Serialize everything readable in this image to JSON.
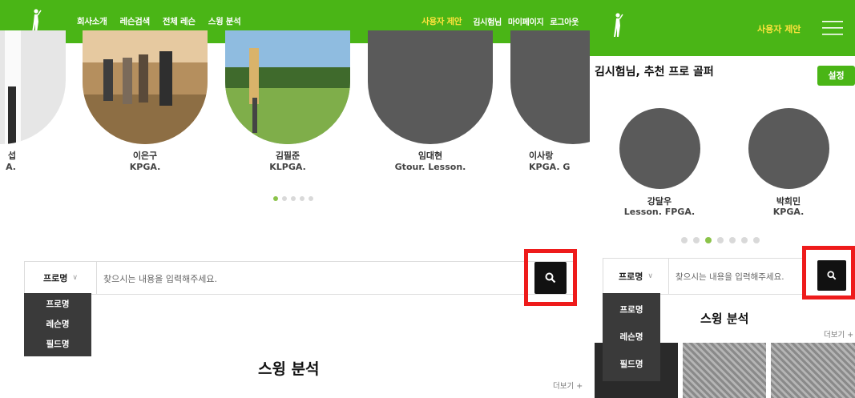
{
  "desktop": {
    "nav": [
      "회사소개",
      "레슨검색",
      "전체 레슨",
      "스윙 분석"
    ],
    "util": {
      "suggest": "사용자 제안",
      "user": "김시험님",
      "mypage": "마이페이지",
      "logout": "로그아웃"
    },
    "pros": [
      {
        "name": "섭",
        "sub": "A."
      },
      {
        "name": "이은구",
        "sub": "KPGA."
      },
      {
        "name": "김필준",
        "sub": "KLPGA."
      },
      {
        "name": "임대현",
        "sub": "Gtour. Lesson."
      },
      {
        "name": "이사랑",
        "sub": "KPGA. G"
      }
    ],
    "search": {
      "category": "프로명",
      "placeholder": "찾으시는 내용을 입력해주세요."
    },
    "dropdown": [
      "프로명",
      "레슨명",
      "필드명"
    ],
    "section_title": "스윙 분석",
    "more": "더보기 +"
  },
  "mobile": {
    "suggest": "사용자 제안",
    "heading": "김시험님, 추천 프로 골퍼",
    "settings": "설정",
    "pros": [
      {
        "name": "강달우",
        "sub": "Lesson. FPGA."
      },
      {
        "name": "박희민",
        "sub": "KPGA."
      }
    ],
    "search": {
      "category": "프로명",
      "placeholder": "찾으시는 내용을 입력해주세요."
    },
    "dropdown": [
      "프로명",
      "레슨명",
      "필드명"
    ],
    "section_title": "스윙 분석",
    "more": "더보기 +"
  },
  "colors": {
    "brand": "#4ab516",
    "accent_text": "#ffe33d",
    "highlight": "#ee1b1b",
    "dot_active": "#8bc34a"
  },
  "icons": {
    "logo": "golfer-logo-icon",
    "search": "search-icon",
    "menu": "hamburger-menu-icon",
    "caret": "chevron-down-icon"
  }
}
